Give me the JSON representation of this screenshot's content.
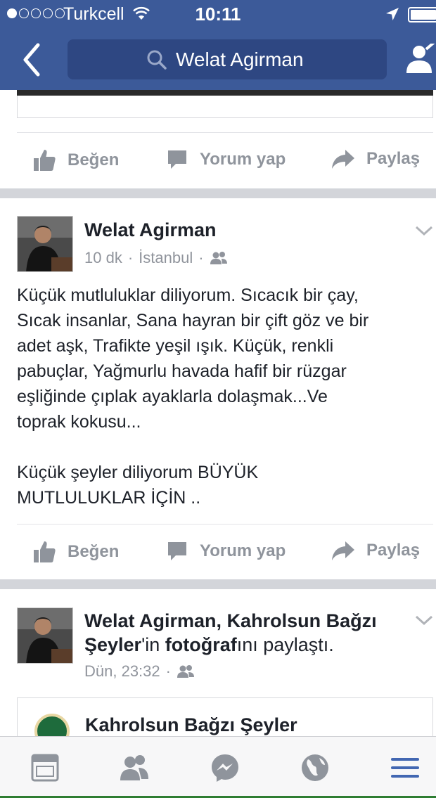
{
  "status_bar": {
    "carrier": "Turkcell",
    "time": "10:11",
    "signal_bars_filled": 1,
    "signal_bars_total": 5
  },
  "nav": {
    "search_text": "Welat Agirman"
  },
  "colors": {
    "brand_blue": "#3c5a99",
    "search_bg": "#2e4782",
    "action_gray": "#8f949c",
    "active_tab_blue": "#4267b2"
  },
  "actions": {
    "like": "Beğen",
    "comment": "Yorum yap",
    "share": "Paylaş"
  },
  "post1": {
    "author": "Welat Agirman",
    "time": "10 dk",
    "location": "İstanbul",
    "privacy_icon": "friends-icon",
    "body": "Küçük mutluluklar diliyorum. Sıcacık bir çay,\nSıcak insanlar, Sana hayran bir çift göz ve bir\nadet aşk, Trafikte yeşil ışık. Küçük, renkli\npabuçlar, Yağmurlu havada hafif bir rüzgar\neşliğinde çıplak ayaklarla dolaşmak...Ve\ntoprak kokusu...\n\nKüçük şeyler diliyorum BÜYÜK\nMUTLULUKLAR İÇİN .."
  },
  "post2": {
    "author": "Welat Agirman",
    "sep": ", ",
    "page": "Kahrolsun Bağzı",
    "page2": "Şeyler",
    "poss": "'in ",
    "photo": "fotoğraf",
    "rest": "ını paylaştı.",
    "time": "Dün, 23:32",
    "shared_title": "Kahrolsun Bağzı Şeyler"
  },
  "tabbar": {
    "tabs": [
      "news-feed-icon",
      "friends-icon",
      "messenger-icon",
      "globe-icon",
      "menu-icon"
    ],
    "active": "menu-icon"
  }
}
